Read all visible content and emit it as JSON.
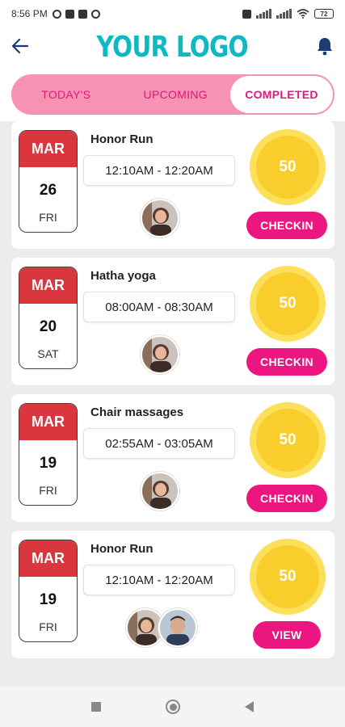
{
  "status_bar": {
    "time": "8:56 PM",
    "battery": "72"
  },
  "header": {
    "logo_text": "YOUR LOGO",
    "back_icon": "arrow-left-icon",
    "bell_icon": "bell-icon"
  },
  "tabs": [
    {
      "label": "TODAY'S",
      "active": false
    },
    {
      "label": "UPCOMING",
      "active": false
    },
    {
      "label": "COMPLETED",
      "active": true
    }
  ],
  "events": [
    {
      "month": "MAR",
      "day": "26",
      "weekday": "FRI",
      "title": "Honor Run",
      "time": "12:10AM - 12:20AM",
      "points": "50",
      "action": "CHECKIN"
    },
    {
      "month": "MAR",
      "day": "20",
      "weekday": "SAT",
      "title": "Hatha yoga",
      "time": "08:00AM - 08:30AM",
      "points": "50",
      "action": "CHECKIN"
    },
    {
      "month": "MAR",
      "day": "19",
      "weekday": "FRI",
      "title": "Chair massages",
      "time": "02:55AM - 03:05AM",
      "points": "50",
      "action": "CHECKIN"
    },
    {
      "month": "MAR",
      "day": "19",
      "weekday": "FRI",
      "title": "Honor Run",
      "time": "12:10AM - 12:20AM",
      "points": "50",
      "action": "VIEW"
    }
  ],
  "colors": {
    "brand": "#0fb9c2",
    "accent": "#ec1680",
    "tab_bg": "#f692b2",
    "month_bg": "#d9363e",
    "points": "#f9cd2c"
  }
}
